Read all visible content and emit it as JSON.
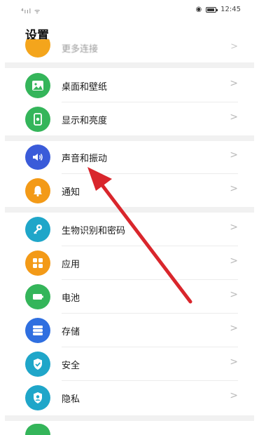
{
  "status_bar": {
    "signal_text": "⁴ııl ᯤ",
    "time": "12:45"
  },
  "page": {
    "title": "设置"
  },
  "partial_item": {
    "label": "更多连接",
    "icon": "link-icon",
    "color": "#f4a51c"
  },
  "items": [
    {
      "label": "桌面和壁纸",
      "icon": "image-icon",
      "color": "#34b55a"
    },
    {
      "label": "显示和亮度",
      "icon": "phone-brightness-icon",
      "color": "#34b55a"
    },
    {
      "label": "声音和振动",
      "icon": "speaker-icon",
      "color": "#3a5bd9"
    },
    {
      "label": "通知",
      "icon": "bell-icon",
      "color": "#f39a17"
    },
    {
      "label": "生物识别和密码",
      "icon": "key-icon",
      "color": "#1fa6c9"
    },
    {
      "label": "应用",
      "icon": "apps-grid-icon",
      "color": "#f39a17"
    },
    {
      "label": "电池",
      "icon": "battery-icon",
      "color": "#34b55a"
    },
    {
      "label": "存储",
      "icon": "storage-icon",
      "color": "#2f6fe0"
    },
    {
      "label": "安全",
      "icon": "shield-check-icon",
      "color": "#1fa6c9"
    },
    {
      "label": "隐私",
      "icon": "privacy-icon",
      "color": "#1fa6c9"
    }
  ],
  "chevron": ">",
  "annotation": {
    "arrow_color": "#d9262c"
  }
}
